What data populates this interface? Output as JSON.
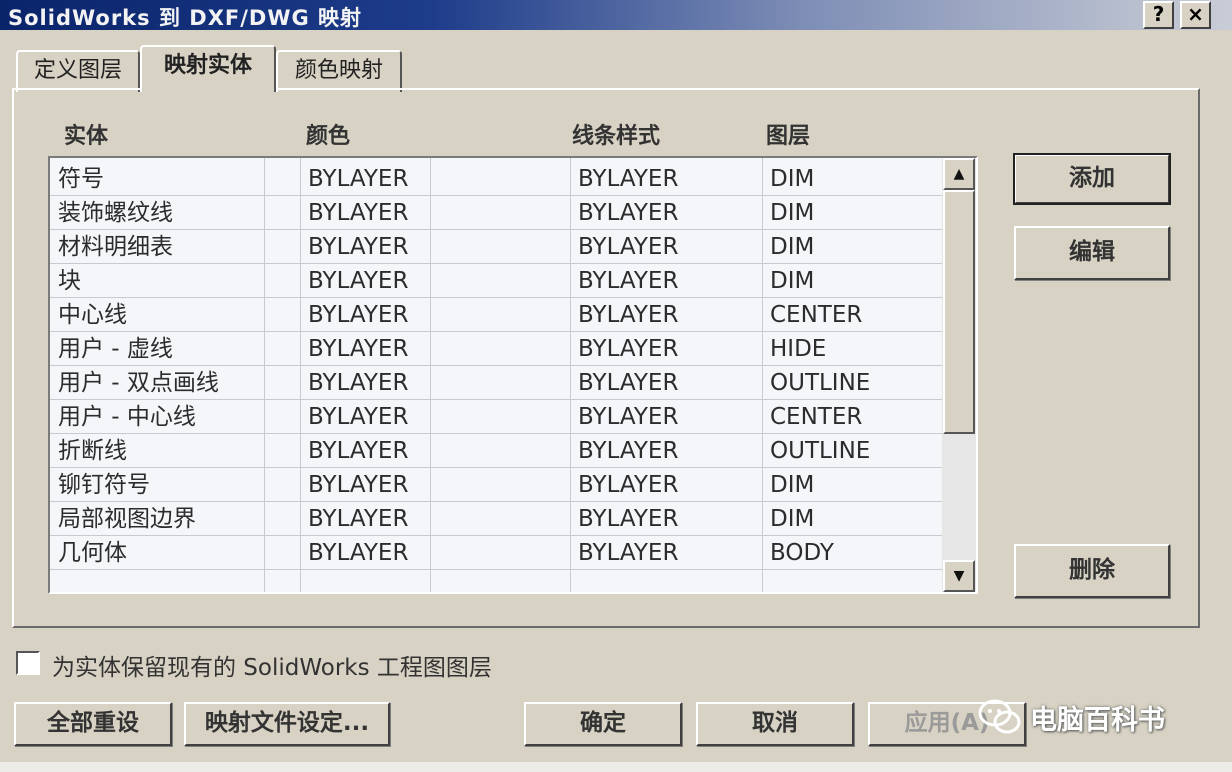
{
  "window": {
    "title": "SolidWorks 到 DXF/DWG 映射",
    "help_label": "?",
    "close_label": "×"
  },
  "tabs": [
    {
      "label": "定义图层"
    },
    {
      "label": "映射实体"
    },
    {
      "label": "颜色映射"
    }
  ],
  "table": {
    "headers": [
      "实体",
      "颜色",
      "线条样式",
      "图层"
    ],
    "rows": [
      {
        "entity": "符号",
        "color": "BYLAYER",
        "linestyle": "BYLAYER",
        "layer": "DIM"
      },
      {
        "entity": "装饰螺纹线",
        "color": "BYLAYER",
        "linestyle": "BYLAYER",
        "layer": "DIM"
      },
      {
        "entity": "材料明细表",
        "color": "BYLAYER",
        "linestyle": "BYLAYER",
        "layer": "DIM"
      },
      {
        "entity": "块",
        "color": "BYLAYER",
        "linestyle": "BYLAYER",
        "layer": "DIM"
      },
      {
        "entity": "中心线",
        "color": "BYLAYER",
        "linestyle": "BYLAYER",
        "layer": "CENTER"
      },
      {
        "entity": "用户 - 虚线",
        "color": "BYLAYER",
        "linestyle": "BYLAYER",
        "layer": "HIDE"
      },
      {
        "entity": "用户 - 双点画线",
        "color": "BYLAYER",
        "linestyle": "BYLAYER",
        "layer": "OUTLINE"
      },
      {
        "entity": "用户 - 中心线",
        "color": "BYLAYER",
        "linestyle": "BYLAYER",
        "layer": "CENTER"
      },
      {
        "entity": "折断线",
        "color": "BYLAYER",
        "linestyle": "BYLAYER",
        "layer": "OUTLINE"
      },
      {
        "entity": "铆钉符号",
        "color": "BYLAYER",
        "linestyle": "BYLAYER",
        "layer": "DIM"
      },
      {
        "entity": "局部视图边界",
        "color": "BYLAYER",
        "linestyle": "BYLAYER",
        "layer": "DIM"
      },
      {
        "entity": "几何体",
        "color": "BYLAYER",
        "linestyle": "BYLAYER",
        "layer": "BODY"
      }
    ]
  },
  "side_buttons": {
    "add": "添加",
    "edit": "编辑",
    "delete": "删除"
  },
  "checkbox": {
    "label": "为实体保留现有的 SolidWorks 工程图图层",
    "checked": false
  },
  "bottom_buttons": {
    "reset_all": "全部重设",
    "map_file_settings": "映射文件设定...",
    "ok": "确定",
    "cancel": "取消",
    "apply": "应用(A)"
  },
  "watermark": {
    "text": "电脑百科书"
  }
}
